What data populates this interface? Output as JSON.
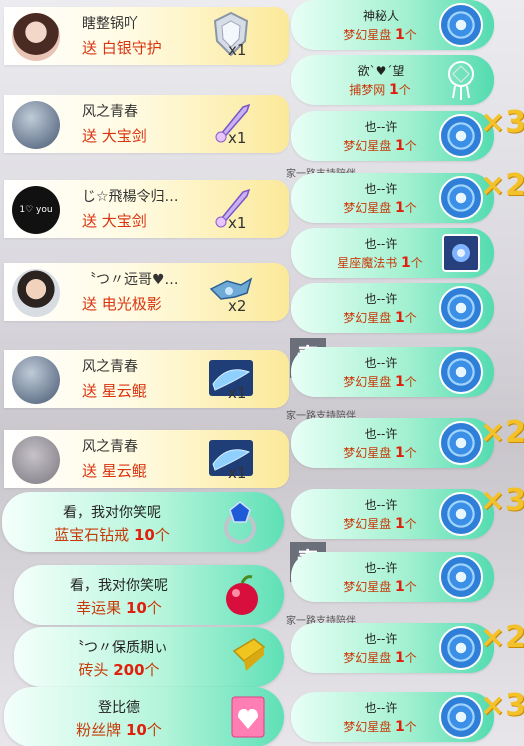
{
  "left_rows": [
    {
      "name": "瞎整锅吖",
      "action": "送",
      "gift": "白银守护",
      "count": "x1"
    },
    {
      "name": "风之青春",
      "action": "送",
      "gift": "大宝剑",
      "count": "x1"
    },
    {
      "name": "じ☆飛楊令归…",
      "action": "送",
      "gift": "大宝剑",
      "count": "x1",
      "avatar_text": "1♡ you"
    },
    {
      "name": "〝つ〃远哥♥…",
      "action": "送",
      "gift": "电光极影",
      "count": "x2"
    },
    {
      "name": "风之青春",
      "action": "送",
      "gift": "星云鲲",
      "count": "x1"
    },
    {
      "name": "风之青春",
      "action": "送",
      "gift": "星云鲲",
      "count": "x1"
    }
  ],
  "green_rows": [
    {
      "name": "看，我对你笑呢",
      "gift": "蓝宝石钻戒",
      "num": "10",
      "unit": "个",
      "icon": "sapphire-ring-icon"
    },
    {
      "name": "看，我对你笑呢",
      "gift": "幸运果",
      "num": "10",
      "unit": "个",
      "icon": "lucky-fruit-icon"
    },
    {
      "name": "〝つ〃保质期ぃ",
      "gift": "砖头",
      "num": "200",
      "unit": "个",
      "icon": "brick-icon"
    },
    {
      "name": "登比德",
      "gift": "粉丝牌",
      "num": "10",
      "unit": "个",
      "icon": "fan-badge-icon"
    }
  ],
  "right_rows": [
    {
      "name": "神秘人",
      "gift": "梦幻星盘",
      "num": "1",
      "unit": "个",
      "icon": "star-disc-icon"
    },
    {
      "name": "欲ˋ♥ˊ望",
      "gift": "捕梦网",
      "num": "1",
      "unit": "个",
      "icon": "dreamcatcher-icon"
    },
    {
      "name": "也--许",
      "gift": "梦幻星盘",
      "num": "1",
      "unit": "个",
      "icon": "star-disc-icon"
    },
    {
      "name": "也--许",
      "gift": "梦幻星盘",
      "num": "1",
      "unit": "个",
      "icon": "star-disc-icon"
    },
    {
      "name": "也--许",
      "gift": "星座魔法书",
      "num": "1",
      "unit": "个",
      "icon": "magic-book-icon"
    },
    {
      "name": "也--许",
      "gift": "梦幻星盘",
      "num": "1",
      "unit": "个",
      "icon": "star-disc-icon"
    },
    {
      "name": "也--许",
      "gift": "梦幻星盘",
      "num": "1",
      "unit": "个",
      "icon": "star-disc-icon"
    },
    {
      "name": "也--许",
      "gift": "梦幻星盘",
      "num": "1",
      "unit": "个",
      "icon": "star-disc-icon"
    },
    {
      "name": "也--许",
      "gift": "梦幻星盘",
      "num": "1",
      "unit": "个",
      "icon": "star-disc-icon"
    },
    {
      "name": "也--许",
      "gift": "梦幻星盘",
      "num": "1",
      "unit": "个",
      "icon": "star-disc-icon"
    },
    {
      "name": "也--许",
      "gift": "梦幻星盘",
      "num": "1",
      "unit": "个",
      "icon": "star-disc-icon"
    },
    {
      "name": "也--许",
      "gift": "梦幻星盘",
      "num": "1",
      "unit": "个",
      "icon": "star-disc-icon"
    }
  ],
  "combos": [
    "×3",
    "×2",
    "×2",
    "×3",
    "×2",
    "×3"
  ],
  "background": {
    "note1": "家一路支持陪伴",
    "note2": "家一路支持陪伴",
    "note3": "家一路支持陪伴",
    "chun1": "春",
    "chun2": "春"
  },
  "colors": {
    "gift_red": "#d9340f",
    "combo_gold": "#f3c12a",
    "green_end": "#5fe0b6"
  }
}
